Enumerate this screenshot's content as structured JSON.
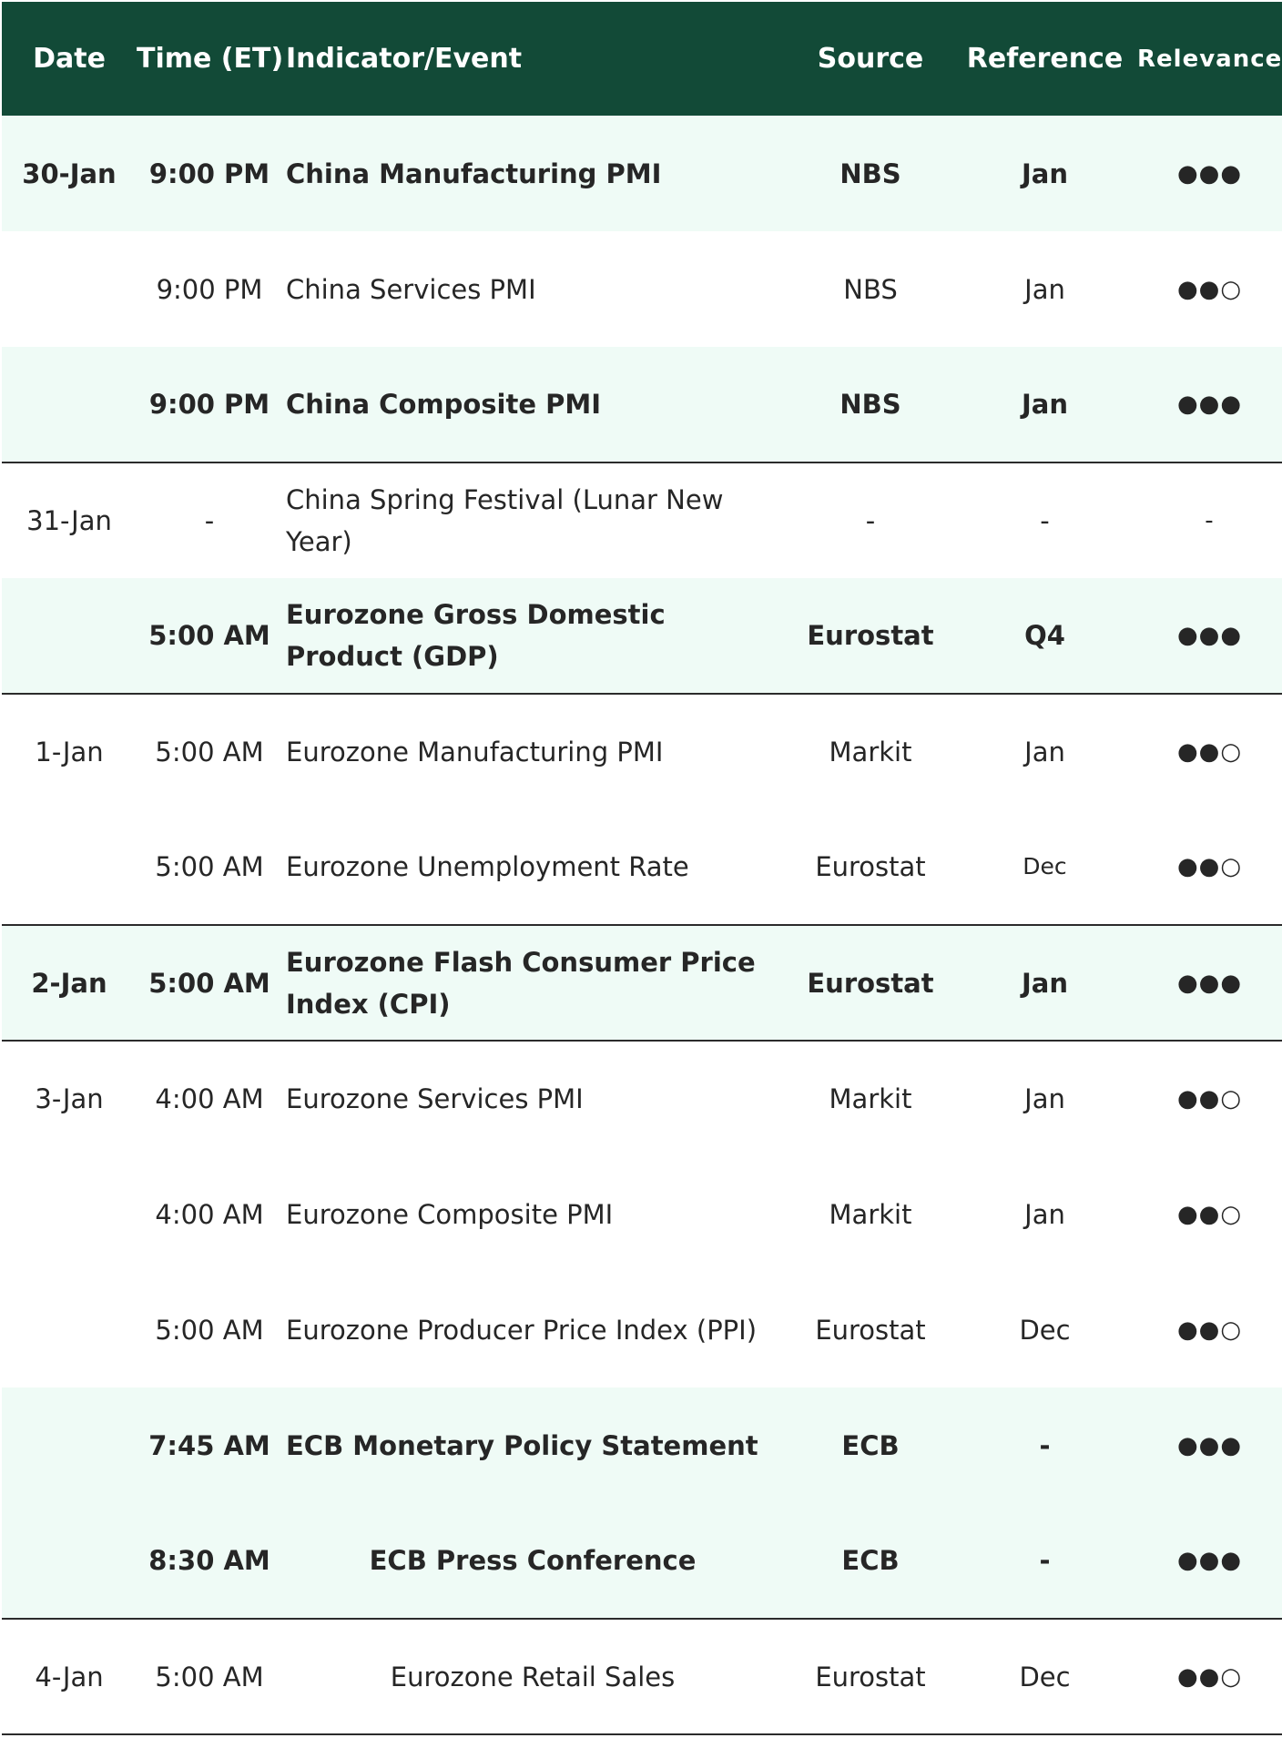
{
  "columns": [
    "Date",
    "Time (ET)",
    "Indicator/Event",
    "Source",
    "Reference",
    "Relevance"
  ],
  "rows": [
    {
      "date": "30-Jan",
      "time": "9:00 PM",
      "indicator": "China Manufacturing PMI",
      "source": "NBS",
      "reference": "Jan",
      "relevance": "●●●",
      "bold": true,
      "shaded": true
    },
    {
      "date": "",
      "time": "9:00 PM",
      "indicator": "China Services PMI",
      "source": "NBS",
      "reference": "Jan",
      "relevance": "●●○"
    },
    {
      "date": "",
      "time": "9:00 PM",
      "indicator": "China Composite PMI",
      "source": "NBS",
      "reference": "Jan",
      "relevance": "●●●",
      "bold": true,
      "shaded": true,
      "groupEnd": true
    },
    {
      "date": "31-Jan",
      "time": "-",
      "indicator": "China Spring Festival (Lunar New Year)",
      "source": "-",
      "reference": "-",
      "relevance": "-"
    },
    {
      "date": "",
      "time": "5:00 AM",
      "indicator": "Eurozone Gross Domestic Product (GDP)",
      "source": "Eurostat",
      "reference": "Q4",
      "relevance": "●●●",
      "bold": true,
      "shaded": true,
      "groupEnd": true
    },
    {
      "date": "1-Jan",
      "time": "5:00 AM",
      "indicator": "Eurozone Manufacturing PMI",
      "source": "Markit",
      "reference": "Jan",
      "relevance": "●●○"
    },
    {
      "date": "",
      "time": "5:00 AM",
      "indicator": "Eurozone Unemployment Rate",
      "source": "Eurostat",
      "reference": "Dec",
      "relevance": "●●○",
      "groupEnd": true,
      "smallRef": true
    },
    {
      "date": "2-Jan",
      "time": "5:00 AM",
      "indicator": "Eurozone Flash Consumer Price Index (CPI)",
      "source": "Eurostat",
      "reference": "Jan",
      "relevance": "●●●",
      "bold": true,
      "shaded": true,
      "groupEnd": true
    },
    {
      "date": "3-Jan",
      "time": "4:00 AM",
      "indicator": "Eurozone Services PMI",
      "source": "Markit",
      "reference": "Jan",
      "relevance": "●●○"
    },
    {
      "date": "",
      "time": "4:00 AM",
      "indicator": "Eurozone Composite PMI",
      "source": "Markit",
      "reference": "Jan",
      "relevance": "●●○"
    },
    {
      "date": "",
      "time": "5:00 AM",
      "indicator": "Eurozone Producer Price Index (PPI)",
      "source": "Eurostat",
      "reference": "Dec",
      "relevance": "●●○"
    },
    {
      "date": "",
      "time": "7:45 AM",
      "indicator": "ECB Monetary Policy Statement",
      "source": "ECB",
      "reference": "-",
      "relevance": "●●●",
      "bold": true,
      "shaded": true
    },
    {
      "date": "",
      "time": "8:30 AM",
      "indicator": "ECB Press Conference",
      "source": "ECB",
      "reference": "-",
      "relevance": "●●●",
      "bold": true,
      "shaded": true,
      "groupEnd": true,
      "centerIndicator": true
    },
    {
      "date": "4-Jan",
      "time": "5:00 AM",
      "indicator": "Eurozone Retail Sales",
      "source": "Eurostat",
      "reference": "Dec",
      "relevance": "●●○",
      "groupEnd": true,
      "centerIndicator": true
    }
  ]
}
